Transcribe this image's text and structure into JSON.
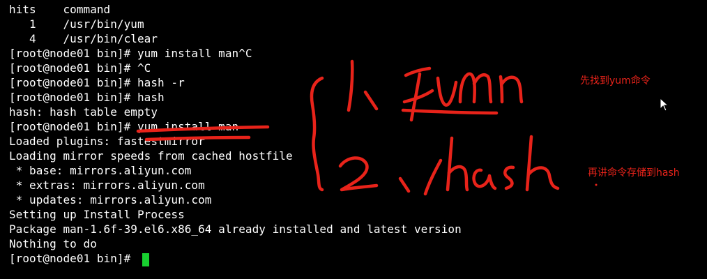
{
  "terminal": {
    "lines": [
      "hits    command",
      "   1    /usr/bin/yum",
      "   4    /usr/bin/clear",
      "[root@node01 bin]# yum install man^C",
      "[root@node01 bin]# ^C",
      "[root@node01 bin]# hash -r",
      "[root@node01 bin]# hash",
      "hash: hash table empty",
      "[root@node01 bin]# yum install man",
      "Loaded plugins: fastestmirror",
      "Loading mirror speeds from cached hostfile",
      " * base: mirrors.aliyun.com",
      " * extras: mirrors.aliyun.com",
      " * updates: mirrors.aliyun.com",
      "Setting up Install Process",
      "Package man-1.6f-39.el6.x86_64 already installed and latest version",
      "Nothing to do",
      "[root@node01 bin]# "
    ],
    "background_color": "#000000",
    "text_color": "#ffffff",
    "cursor_color": "#18d030"
  },
  "annotations": {
    "note_find_yum": "先找到yum命令",
    "note_store_hash": "再讲命令存储到hash",
    "handwriting_step1": "1. yum",
    "handwriting_step2": "2. hash",
    "ink_color": "#e8231a"
  }
}
